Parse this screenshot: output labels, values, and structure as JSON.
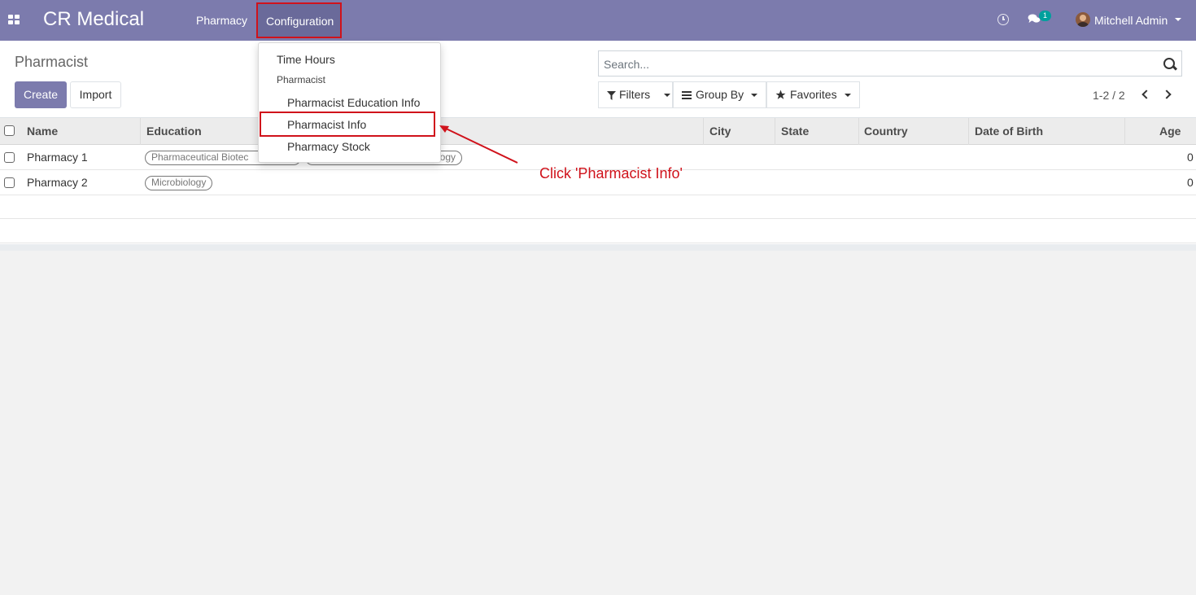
{
  "navbar": {
    "brand": "CR Medical",
    "menus": [
      "Pharmacy",
      "Configuration"
    ],
    "chat_badge": "1",
    "user": "Mitchell Admin"
  },
  "control_panel": {
    "breadcrumb": "Pharmacist",
    "create_label": "Create",
    "import_label": "Import",
    "search_placeholder": "Search...",
    "filters_label": "Filters",
    "groupby_label": "Group By",
    "favorites_label": "Favorites",
    "pager": "1-2 / 2"
  },
  "table": {
    "columns": [
      "Name",
      "Education",
      "City",
      "State",
      "Country",
      "Date of Birth",
      "Age"
    ],
    "rows": [
      {
        "name": "Pharmacy 1",
        "tags": [
          "Pharmaceutical Biotec",
          "ogy"
        ],
        "age": "0"
      },
      {
        "name": "Pharmacy 2",
        "tags": [
          "Microbiology"
        ],
        "age": "0"
      }
    ]
  },
  "dropdown": {
    "time_hours": "Time Hours",
    "section_header": "Pharmacist",
    "education_info": "Pharmacist Education Info",
    "pharmacist_info": "Pharmacist Info",
    "pharmacy_stock": "Pharmacy Stock"
  },
  "annotation": "Click 'Pharmacist Info'",
  "colors": {
    "navbar": "#7c7bad",
    "highlight": "#d0121b",
    "badge": "#00a09d"
  }
}
